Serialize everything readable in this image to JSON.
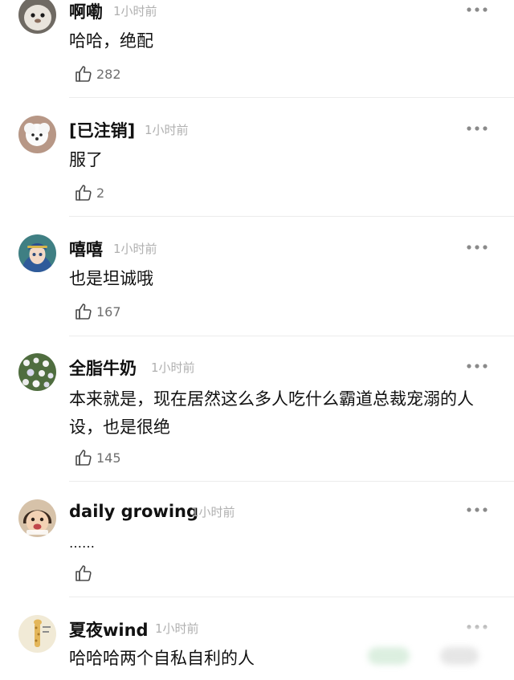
{
  "comments": [
    {
      "username": "啊嘞",
      "time": "1小时前",
      "text": "哈哈，绝配",
      "likes": "282",
      "avatar_icon": "seal-avatar-icon"
    },
    {
      "username": "[已注销]",
      "time": "1小时前",
      "text": "服了",
      "likes": "2",
      "avatar_icon": "white-dog-avatar-icon"
    },
    {
      "username": "嘻嘻",
      "time": "1小时前",
      "text": "也是坦诚哦",
      "likes": "167",
      "avatar_icon": "anime-girl-avatar-icon"
    },
    {
      "username": "全脂牛奶",
      "time": "1小时前",
      "text": "本来就是，现在居然这么多人吃什么霸道总裁宠溺的人设，也是很绝",
      "likes": "145",
      "avatar_icon": "flowers-avatar-icon"
    },
    {
      "username": "daily growing",
      "time": "1小时前",
      "text": "……",
      "likes": "",
      "avatar_icon": "child-avatar-icon"
    },
    {
      "username": "夏夜wind",
      "time": "1小时前",
      "text": "哈哈哈两个自私自利的人",
      "likes": "",
      "avatar_icon": "giraffe-avatar-icon"
    }
  ],
  "icons": {
    "like": "thumbs-up-outline-icon",
    "more": "more-dots-icon"
  },
  "colors": {
    "text": "#111111",
    "time": "#b0b0b0",
    "count": "#6f6f6f",
    "divider": "#ececec"
  }
}
